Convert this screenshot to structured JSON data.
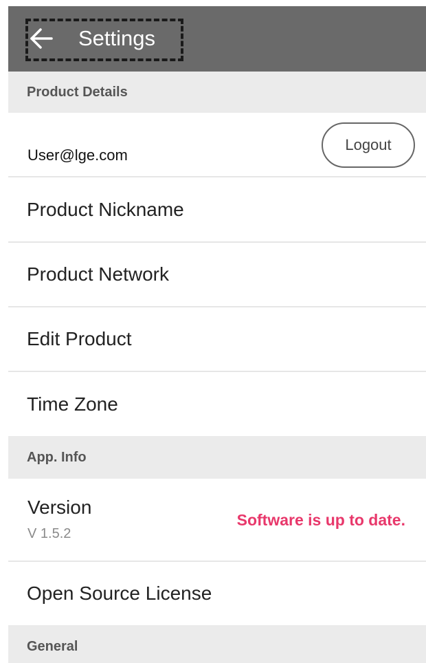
{
  "header": {
    "title": "Settings",
    "back_icon": "arrow-left-icon"
  },
  "sections": {
    "product_details": "Product Details",
    "app_info": "App. Info",
    "general": "General"
  },
  "account": {
    "email": "User@lge.com",
    "logout_label": "Logout"
  },
  "product_items": [
    {
      "label": "Product Nickname"
    },
    {
      "label": "Product Network"
    },
    {
      "label": "Edit Product"
    },
    {
      "label": "Time Zone"
    }
  ],
  "app_info": {
    "version_label": "Version",
    "version_number": "V 1.5.2",
    "version_status": "Software is up to date.",
    "open_source_label": "Open Source License"
  },
  "colors": {
    "topbar": "#6a6a6a",
    "section_bg": "#ebebeb",
    "status_accent": "#e8386b"
  }
}
